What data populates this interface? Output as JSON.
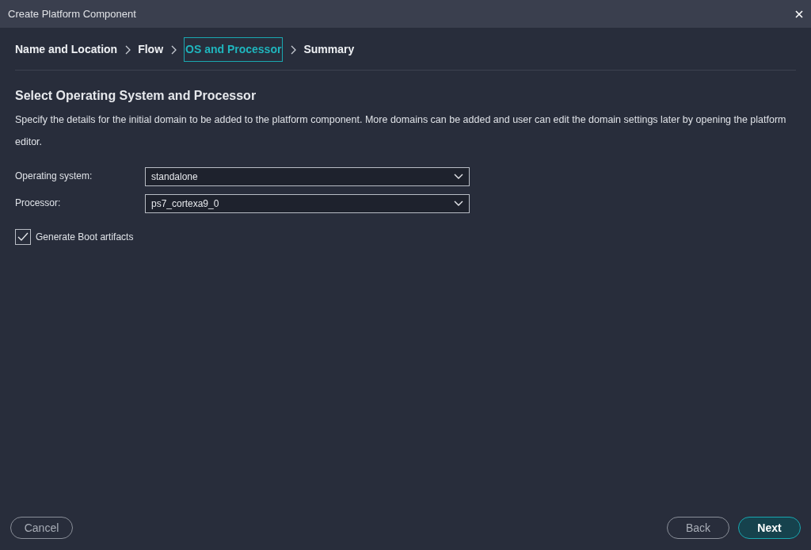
{
  "window": {
    "title": "Create Platform Component"
  },
  "steps": [
    {
      "label": "Name and Location",
      "selected": false
    },
    {
      "label": "Flow",
      "selected": false
    },
    {
      "label": "OS and Processor",
      "selected": true
    },
    {
      "label": "Summary",
      "selected": false
    }
  ],
  "heading": "Select Operating System and Processor",
  "description": "Specify the details for the initial domain to be added to the platform component. More domains can be added and user can edit the domain settings later by opening the platform editor.",
  "fields": [
    {
      "label": "Operating system:",
      "value": "standalone"
    },
    {
      "label": "Processor:",
      "value": "ps7_cortexa9_0"
    }
  ],
  "checkbox": {
    "label": "Generate Boot artifacts",
    "checked": true
  },
  "buttons": [
    {
      "label": "Cancel",
      "kind": "outline"
    },
    {
      "label": "Back",
      "kind": "outline"
    },
    {
      "label": "Next",
      "kind": "primary"
    }
  ]
}
